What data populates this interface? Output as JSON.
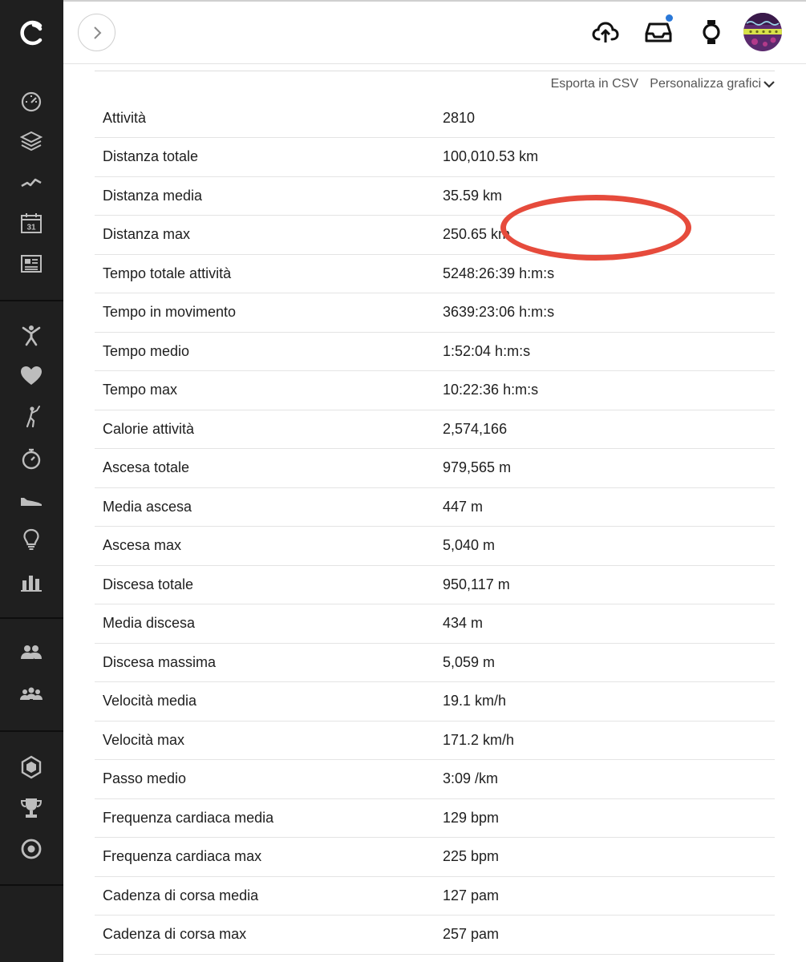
{
  "sidebar": {
    "logo_icon": "garmin-connect-logo",
    "items_group1": [
      {
        "icon": "dashboard-gauge-icon"
      },
      {
        "icon": "activities-layers-icon"
      },
      {
        "icon": "insights-trend-icon"
      },
      {
        "icon": "calendar-icon",
        "text": "31"
      },
      {
        "icon": "news-feed-icon"
      }
    ],
    "items_group2": [
      {
        "icon": "arms-up-person-icon"
      },
      {
        "icon": "heart-icon"
      },
      {
        "icon": "golf-icon"
      },
      {
        "icon": "stopwatch-icon"
      },
      {
        "icon": "shoe-icon"
      },
      {
        "icon": "lightbulb-icon"
      },
      {
        "icon": "bar-chart-icon"
      }
    ],
    "items_group3": [
      {
        "icon": "connections-icon"
      },
      {
        "icon": "groups-icon"
      }
    ],
    "items_group4": [
      {
        "icon": "badge-hexagon-icon"
      },
      {
        "icon": "trophy-icon"
      },
      {
        "icon": "goal-target-icon"
      }
    ]
  },
  "topbar": {
    "upload_icon": "cloud-upload-icon",
    "inbox_icon": "inbox-tray-icon",
    "device_icon": "watch-icon",
    "notification_color": "#2a78d8"
  },
  "actions": {
    "export_label": "Esporta in CSV",
    "customize_label": "Personalizza grafici"
  },
  "stats": [
    {
      "label": "Attività",
      "value": "2810"
    },
    {
      "label": "Distanza totale",
      "value": "100,010.53 km"
    },
    {
      "label": "Distanza media",
      "value": "35.59 km"
    },
    {
      "label": "Distanza max",
      "value": "250.65 km"
    },
    {
      "label": "Tempo totale attività",
      "value": "5248:26:39 h:m:s"
    },
    {
      "label": "Tempo in movimento",
      "value": "3639:23:06 h:m:s"
    },
    {
      "label": "Tempo medio",
      "value": "1:52:04 h:m:s"
    },
    {
      "label": "Tempo max",
      "value": "10:22:36 h:m:s"
    },
    {
      "label": "Calorie attività",
      "value": "2,574,166"
    },
    {
      "label": "Ascesa totale",
      "value": "979,565 m"
    },
    {
      "label": "Media ascesa",
      "value": "447 m"
    },
    {
      "label": "Ascesa max",
      "value": "5,040 m"
    },
    {
      "label": "Discesa totale",
      "value": "950,117 m"
    },
    {
      "label": "Media discesa",
      "value": "434 m"
    },
    {
      "label": "Discesa massima",
      "value": "5,059 m"
    },
    {
      "label": "Velocità media",
      "value": "19.1 km/h"
    },
    {
      "label": "Velocità max",
      "value": "171.2 km/h"
    },
    {
      "label": "Passo medio",
      "value": "3:09 /km"
    },
    {
      "label": "Frequenza cardiaca media",
      "value": "129 bpm"
    },
    {
      "label": "Frequenza cardiaca max",
      "value": "225 bpm"
    },
    {
      "label": "Cadenza di corsa media",
      "value": "127 pam"
    },
    {
      "label": "Cadenza di corsa max",
      "value": "257 pam"
    }
  ],
  "annotation": {
    "highlighted_row": "Distanza totale",
    "color": "#e64b3c"
  }
}
